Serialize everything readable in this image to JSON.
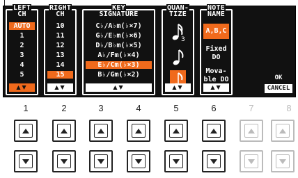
{
  "groups": {
    "left_ch": {
      "title_line1": "LEFT",
      "title_line2": "CH",
      "options": [
        "AUTO",
        "1",
        "2",
        "3",
        "4",
        "5"
      ],
      "selected": "AUTO",
      "arrows": "▲▼"
    },
    "right_ch": {
      "title_line1": "RIGHT",
      "title_line2": "CH",
      "options": [
        "10",
        "11",
        "12",
        "13",
        "14",
        "15"
      ],
      "selected": "15",
      "arrows": "▲▼"
    },
    "key_signature": {
      "title_line1": "KEY",
      "title_line2": "SIGNATURE",
      "options": [
        "C♭/A♭m(♭×7)",
        "G♭/E♭m(♭×6)",
        "D♭/B♭m(♭×5)",
        "A♭/Fm(♭×4)",
        "E♭/Cm(♭×3)",
        "B♭/Gm(♭×2)"
      ],
      "selected": "E♭/Cm(♭×3)",
      "arrows": "▲▼"
    },
    "quantize": {
      "title_line1": "QUAN-",
      "title_line2": "TIZE",
      "options": [
        "sixteenth-triplet-note-icon",
        "eighth-note-icon",
        "eighth-triplet-note-icon"
      ],
      "selected": "eighth-triplet-note-icon",
      "triplet_digit": "3",
      "arrows": "▲▼"
    },
    "note_name": {
      "title_line1": "NOTE",
      "title_line2": "NAME",
      "options": [
        "A,B,C",
        "Fixed DO",
        "Mova-ble DO"
      ],
      "option_lines": [
        [
          "A,B,C"
        ],
        [
          "Fixed",
          "DO"
        ],
        [
          "Mova-",
          "ble DO"
        ]
      ],
      "selected": "A,B,C",
      "arrows": "▲▼"
    }
  },
  "ok_label": "OK",
  "cancel_label": "CANCEL",
  "hardware_buttons": [
    "1",
    "2",
    "3",
    "4",
    "5",
    "6",
    "7",
    "8"
  ],
  "colors": {
    "lcd_background": "#111111",
    "selection": "#f06a1c",
    "frame": "#ffffff"
  }
}
